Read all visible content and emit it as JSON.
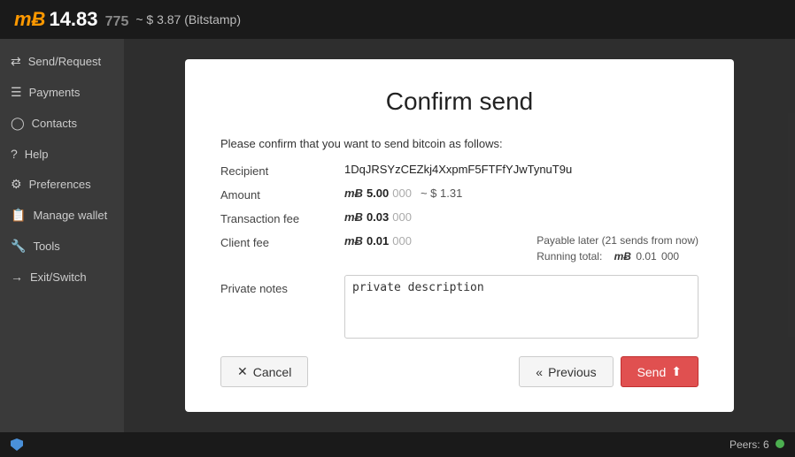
{
  "topbar": {
    "mbtc_symbol": "mɃ",
    "balance": "14.83",
    "balance_muted": "775",
    "fiat": "~ $ 3.87 (Bitstamp)"
  },
  "sidebar": {
    "items": [
      {
        "id": "send-request",
        "label": "Send/Request",
        "icon": "⇄"
      },
      {
        "id": "payments",
        "label": "Payments",
        "icon": "≡"
      },
      {
        "id": "contacts",
        "label": "Contacts",
        "icon": "👤"
      },
      {
        "id": "help",
        "label": "Help",
        "icon": "?"
      },
      {
        "id": "preferences",
        "label": "Preferences",
        "icon": "⚙"
      },
      {
        "id": "manage-wallet",
        "label": "Manage wallet",
        "icon": "📋"
      },
      {
        "id": "tools",
        "label": "Tools",
        "icon": "🔧"
      },
      {
        "id": "exit-switch",
        "label": "Exit/Switch",
        "icon": "→"
      }
    ]
  },
  "dialog": {
    "title": "Confirm send",
    "intro": "Please confirm that you want to send bitcoin as follows:",
    "fields": {
      "recipient_label": "Recipient",
      "recipient_value": "1DqJRSYzCEZkj4XxpmF5FTFfYJwTynuT9u",
      "amount_label": "Amount",
      "amount_value": "5.00",
      "amount_muted": "000",
      "amount_fiat": "~ $ 1.31",
      "txfee_label": "Transaction fee",
      "txfee_value": "0.03",
      "txfee_muted": "000",
      "clientfee_label": "Client fee",
      "clientfee_value": "0.01",
      "clientfee_muted": "000",
      "payable_later": "Payable later (21  sends from now)",
      "running_total_label": "Running total:",
      "running_total_value": "0.01",
      "running_total_muted": "000",
      "notes_label": "Private notes",
      "notes_placeholder": "private description"
    },
    "buttons": {
      "cancel": "Cancel",
      "previous": "Previous",
      "send": "Send"
    }
  },
  "statusbar": {
    "peers_label": "Peers: 6"
  }
}
